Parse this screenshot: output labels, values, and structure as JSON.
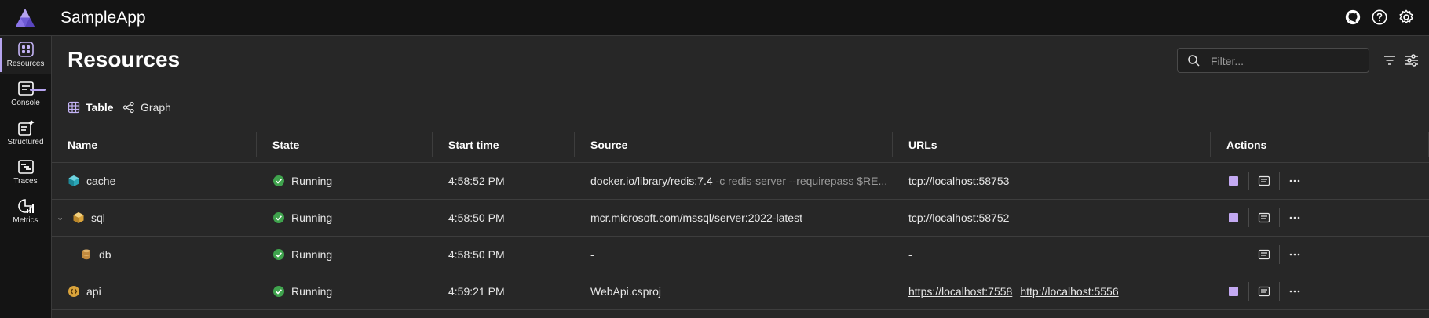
{
  "app": {
    "title": "SampleApp"
  },
  "topbar": {
    "icons": [
      "github-icon",
      "help-icon",
      "settings-icon"
    ]
  },
  "nav": {
    "items": [
      {
        "label": "Resources",
        "icon": "resources-icon",
        "active": true
      },
      {
        "label": "Console",
        "icon": "console-icon"
      },
      {
        "label": "Structured",
        "icon": "structured-icon"
      },
      {
        "label": "Traces",
        "icon": "traces-icon"
      },
      {
        "label": "Metrics",
        "icon": "metrics-icon"
      }
    ]
  },
  "page": {
    "title": "Resources"
  },
  "filter": {
    "placeholder": "Filter..."
  },
  "tabs": [
    {
      "label": "Table",
      "icon": "table-icon",
      "selected": true
    },
    {
      "label": "Graph",
      "icon": "graph-icon"
    }
  ],
  "table": {
    "columns": [
      "Name",
      "State",
      "Start time",
      "Source",
      "URLs",
      "Actions"
    ],
    "rows": [
      {
        "name": "cache",
        "icon": "container-icon",
        "state": "Running",
        "start": "4:58:52 PM",
        "source": "docker.io/library/redis:7.4",
        "source_args": "-c redis-server --requirepass $RE...",
        "urls": [
          "tcp://localhost:58753"
        ]
      },
      {
        "name": "sql",
        "icon": "container-icon",
        "state": "Running",
        "start": "4:58:50 PM",
        "source": "mcr.microsoft.com/mssql/server:2022-latest",
        "source_args": "",
        "urls": [
          "tcp://localhost:58752"
        ]
      },
      {
        "name": "db",
        "icon": "database-icon",
        "state": "Running",
        "start": "4:58:50 PM",
        "source": "-",
        "source_args": "",
        "urls": [
          "-"
        ]
      },
      {
        "name": "api",
        "icon": "project-icon",
        "state": "Running",
        "start": "4:59:21 PM",
        "source": "WebApi.csproj",
        "source_args": "",
        "urls": [
          "https://localhost:7558",
          "http://localhost:5556"
        ]
      }
    ]
  },
  "colors": {
    "accent": "#b6a4ef",
    "running": "#3fa34d",
    "background": "#272727",
    "chrome": "#141414"
  }
}
